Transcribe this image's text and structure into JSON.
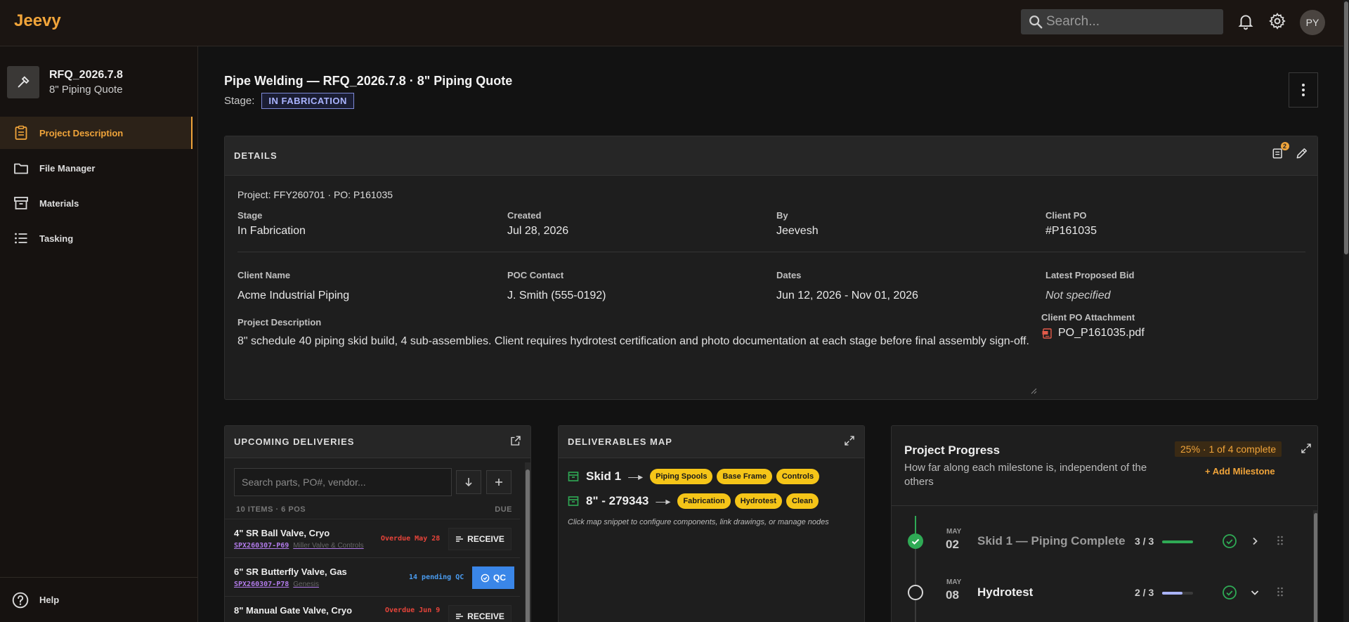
{
  "app": {
    "brand": "Jeevy",
    "search_placeholder": "Search...",
    "avatar_initials": "PY"
  },
  "sidebar": {
    "project_code": "RFQ_2026.7.8",
    "project_name": "8\" Piping Quote",
    "items": [
      {
        "label": "Project Description",
        "icon": "clipboard-icon",
        "active": true
      },
      {
        "label": "File Manager",
        "icon": "folder-icon",
        "active": false
      },
      {
        "label": "Materials",
        "icon": "archive-box-icon",
        "active": false
      },
      {
        "label": "Tasking",
        "icon": "list-icon",
        "active": false
      }
    ],
    "help_label": "Help"
  },
  "header": {
    "title": "Pipe Welding — RFQ_2026.7.8 · 8\" Piping Quote",
    "stage_label": "Stage:",
    "stage_value": "IN FABRICATION"
  },
  "details": {
    "heading": "DETAILS",
    "notification_count": "2",
    "project_line": "Project: FFY260701 · PO: P161035",
    "fields": {
      "stage": {
        "label": "Stage",
        "value": "In Fabrication"
      },
      "created": {
        "label": "Created",
        "value": "Jul 28, 2026"
      },
      "by": {
        "label": "By",
        "value": "Jeevesh"
      },
      "client_po": {
        "label": "Client PO",
        "value": "#P161035"
      },
      "client_name": {
        "label": "Client Name",
        "value": "Acme Industrial Piping"
      },
      "poc": {
        "label": "POC Contact",
        "value": "J. Smith (555-0192)"
      },
      "dates": {
        "label": "Dates",
        "value": "Jun 12, 2026 - Nov 01, 2026"
      },
      "bid": {
        "label": "Latest Proposed Bid",
        "value": "Not specified"
      },
      "attachment": {
        "label": "Client PO Attachment",
        "value": "PO_P161035.pdf"
      },
      "description": {
        "label": "Project Description",
        "value": "8\" schedule 40 piping skid build, 4 sub-assemblies. Client requires hydrotest certification and photo documentation at each stage before final assembly sign-off."
      }
    }
  },
  "deliveries": {
    "heading": "UPCOMING DELIVERIES",
    "search_placeholder": "Search parts, PO#, vendor...",
    "meta": "10 ITEMS · 6 POS",
    "due_label": "DUE",
    "rows": [
      {
        "name": "4\" SR Ball Valve, Cryo",
        "code": "SPX260307-P69",
        "vendor": "Miller Valve & Controls",
        "due": "Overdue May 28",
        "due_color": "#e8443a",
        "action": "RECEIVE"
      },
      {
        "name": "6\" SR Butterfly Valve, Gas",
        "code": "SPX260307-P78",
        "vendor": "Genesis",
        "due": "14 pending QC",
        "due_color": "#4a9cf0",
        "action": "QC"
      },
      {
        "name": "8\" Manual Gate Valve, Cryo",
        "code": "",
        "vendor": "",
        "due": "Overdue Jun 9",
        "due_color": "#e8443a",
        "action": "RECEIVE"
      }
    ]
  },
  "deliverables_map": {
    "heading": "DELIVERABLES MAP",
    "rows": [
      {
        "label": "Skid 1",
        "chips": [
          "Piping Spools",
          "Base Frame",
          "Controls"
        ]
      },
      {
        "label": "8\" - 279343",
        "chips": [
          "Fabrication",
          "Hydrotest",
          "Clean"
        ]
      }
    ],
    "arrow": "—▸",
    "note": "Click map snippet to configure components, link drawings, or manage nodes"
  },
  "progress": {
    "title": "Project Progress",
    "subtitle": "How far along each milestone is, independent of the others",
    "badge": "25% · 1 of 4 complete",
    "add_label": "+ Add Milestone",
    "milestones": [
      {
        "month": "MAY",
        "day": "02",
        "name": "Skid 1 — Piping Complete",
        "count": "3 / 3",
        "fraction": 1.0,
        "bar_color": "#2faa55",
        "done": true,
        "name_color": "#9a9a9a"
      },
      {
        "month": "MAY",
        "day": "08",
        "name": "Hydrotest",
        "count": "2 / 3",
        "fraction": 0.67,
        "bar_color": "#aab4ff",
        "done": false,
        "name_color": "#eeeeee"
      }
    ]
  }
}
